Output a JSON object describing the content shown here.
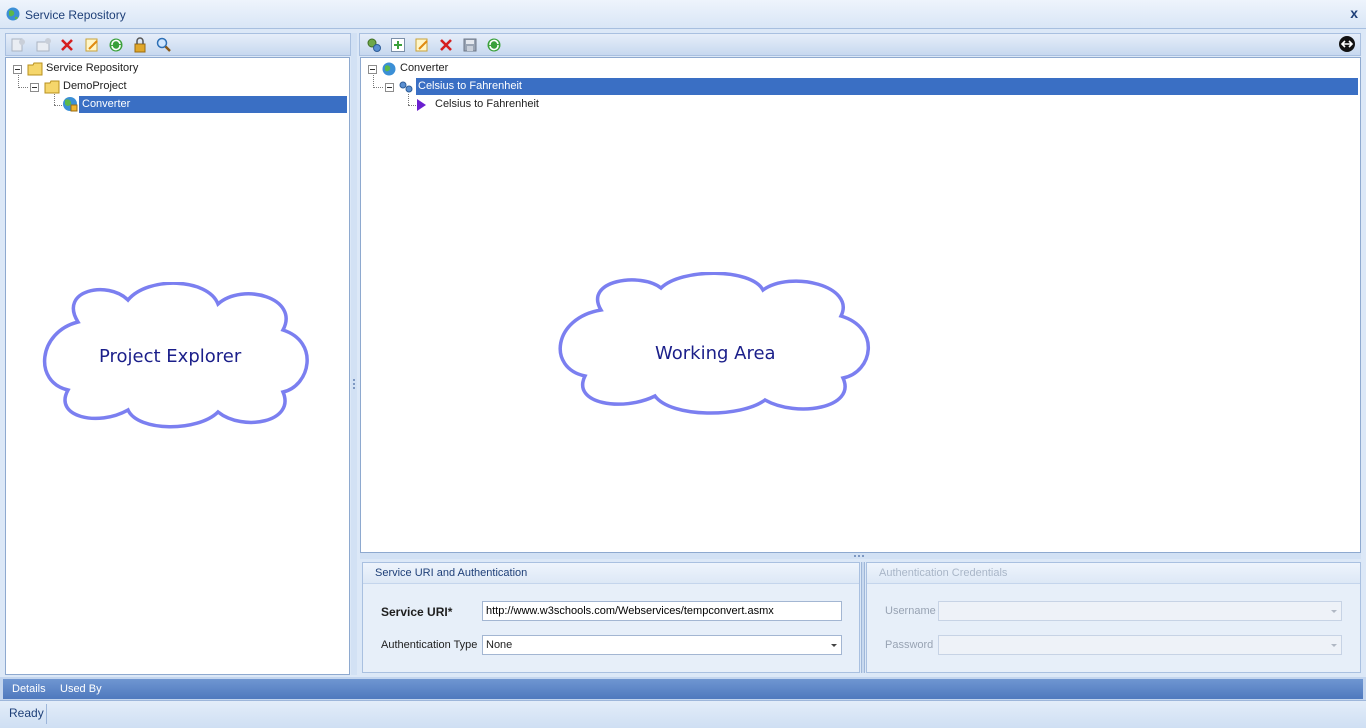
{
  "window": {
    "title": "Service Repository",
    "close_label": "x"
  },
  "project_explorer": {
    "tree": {
      "root": "Service Repository",
      "project": "DemoProject",
      "service": "Converter"
    },
    "callout": "Project Explorer"
  },
  "working_area": {
    "tree": {
      "service": "Converter",
      "operation": "Celsius to Fahrenheit",
      "method": "Celsius to Fahrenheit"
    },
    "callout": "Working Area"
  },
  "service_uri_group": {
    "header": "Service URI and Authentication",
    "uri_label": "Service URI*",
    "uri_value": "http://www.w3schools.com/Webservices/tempconvert.asmx",
    "auth_label": "Authentication Type",
    "auth_value": "None"
  },
  "credentials_group": {
    "header": "Authentication Credentials",
    "username_label": "Username",
    "password_label": "Password"
  },
  "bottom_tabs": [
    "Details",
    "Used By"
  ],
  "status": {
    "text": "Ready"
  },
  "colors": {
    "selection": "#3a6fc4",
    "callout_stroke": "#7b7ff0",
    "callout_text": "#1b1f8a"
  }
}
